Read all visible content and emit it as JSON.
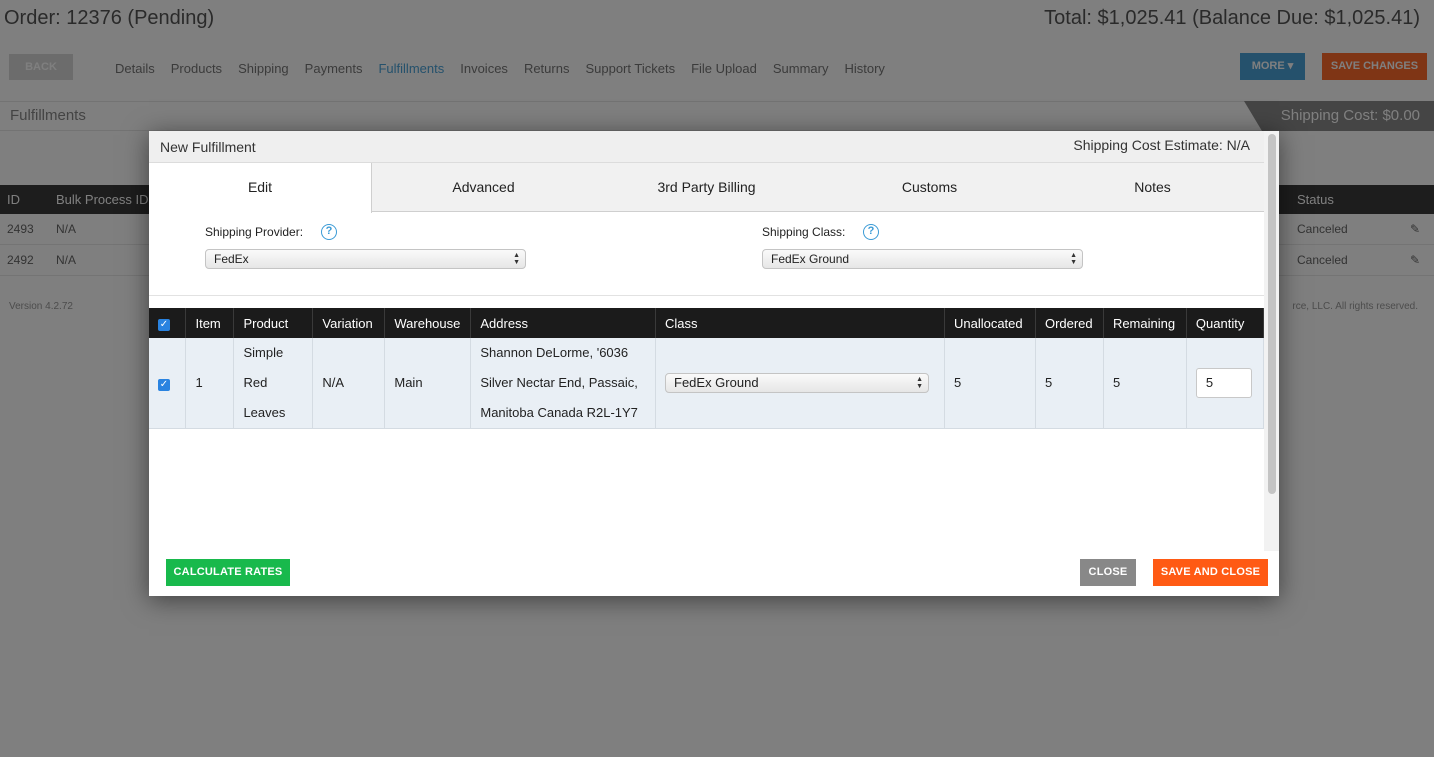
{
  "background": {
    "order_title": "Order: 12376 (Pending)",
    "order_total": "Total: $1,025.41 (Balance Due: $1,025.41)",
    "back_label": "BACK",
    "nav_tabs": [
      "Details",
      "Products",
      "Shipping",
      "Payments",
      "Fulfillments",
      "Invoices",
      "Returns",
      "Support Tickets",
      "File Upload",
      "Summary",
      "History"
    ],
    "active_nav": "Fulfillments",
    "more_label": "MORE ▾",
    "save_changes_label": "SAVE CHANGES",
    "section_title": "Fulfillments",
    "shipping_cost": "Shipping Cost: $0.00",
    "table_headers": {
      "id": "ID",
      "bulk": "Bulk Process ID",
      "status": "Status"
    },
    "rows": [
      {
        "id": "2493",
        "bulk": "N/A",
        "status": "Canceled"
      },
      {
        "id": "2492",
        "bulk": "N/A",
        "status": "Canceled"
      }
    ],
    "version": "Version 4.2.72",
    "copyright": "rce, LLC. All rights reserved."
  },
  "modal": {
    "title": "New Fulfillment",
    "estimate": "Shipping Cost Estimate: N/A",
    "tabs": [
      "Edit",
      "Advanced",
      "3rd Party Billing",
      "Customs",
      "Notes"
    ],
    "active_tab": "Edit",
    "shipping_provider": {
      "label": "Shipping Provider:",
      "value": "FedEx"
    },
    "shipping_class": {
      "label": "Shipping Class:",
      "value": "FedEx Ground"
    },
    "table": {
      "headers": [
        "Item",
        "Product",
        "Variation",
        "Warehouse",
        "Address",
        "Class",
        "Unallocated",
        "Ordered",
        "Remaining",
        "Quantity"
      ],
      "rows": [
        {
          "item": "1",
          "product": "Simple Red Leaves",
          "variation": "N/A",
          "warehouse": "Main",
          "address": "Shannon DeLorme, '6036 Silver Nectar End, Passaic, Manitoba Canada R2L-1Y7",
          "class": "FedEx Ground",
          "unallocated": "5",
          "ordered": "5",
          "remaining": "5",
          "quantity": "5"
        }
      ]
    },
    "buttons": {
      "calculate": "CALCULATE RATES",
      "close": "CLOSE",
      "save_close": "SAVE AND CLOSE"
    }
  },
  "colors": {
    "accent_blue": "#3b9bd6",
    "green": "#18b94c",
    "orange": "#ff5a14",
    "gray_button": "#888888",
    "table_header": "#1b1b1b"
  }
}
